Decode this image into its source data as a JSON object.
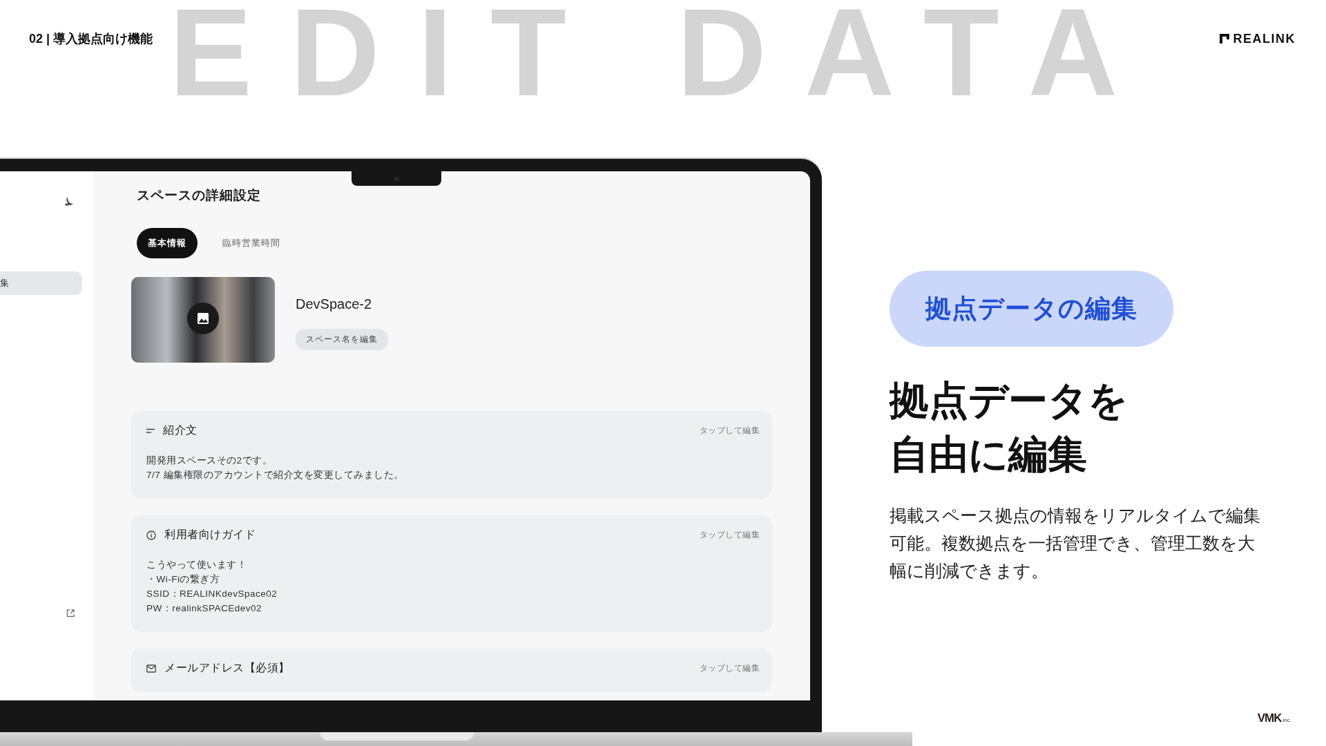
{
  "header": {
    "section": "02 | 導入拠点向け機能",
    "logo": "REALINK",
    "backdrop_text": "EDIT DATA"
  },
  "app": {
    "sidebar": {
      "items": [
        {
          "label": "集",
          "selected": true
        }
      ]
    },
    "title": "スペースの詳細設定",
    "tabs": [
      {
        "label": "基本情報",
        "selected": true
      },
      {
        "label": "臨時営業時間",
        "selected": false
      }
    ],
    "space": {
      "name": "DevSpace-2",
      "rename_button": "スペース名を編集"
    },
    "sections": [
      {
        "kind": "text",
        "title": "紹介文",
        "action": "タップして編集",
        "lines": [
          "開発用スペースその2です。",
          "7/7 編集権限のアカウントで紹介文を変更してみました。"
        ]
      },
      {
        "kind": "info",
        "title": "利用者向けガイド",
        "action": "タップして編集",
        "lines": [
          "こうやって使います！",
          "・Wi-Fiの繋ぎ方",
          "SSID：REALINKdevSpace02",
          "PW：realinkSPACEdev02"
        ]
      },
      {
        "kind": "mail",
        "title": "メールアドレス【必須】",
        "action": "タップして編集"
      }
    ]
  },
  "feature": {
    "badge": "拠点データの編集",
    "headline_lines": [
      "拠点データを",
      "自由に編集"
    ],
    "description": "掲載スペース拠点の情報をリアルタイムで編集可能。複数拠点を一括管理でき、管理工数を大幅に削減できます。"
  },
  "footer": {
    "logo": "VMK",
    "logo_suffix": "inc."
  }
}
